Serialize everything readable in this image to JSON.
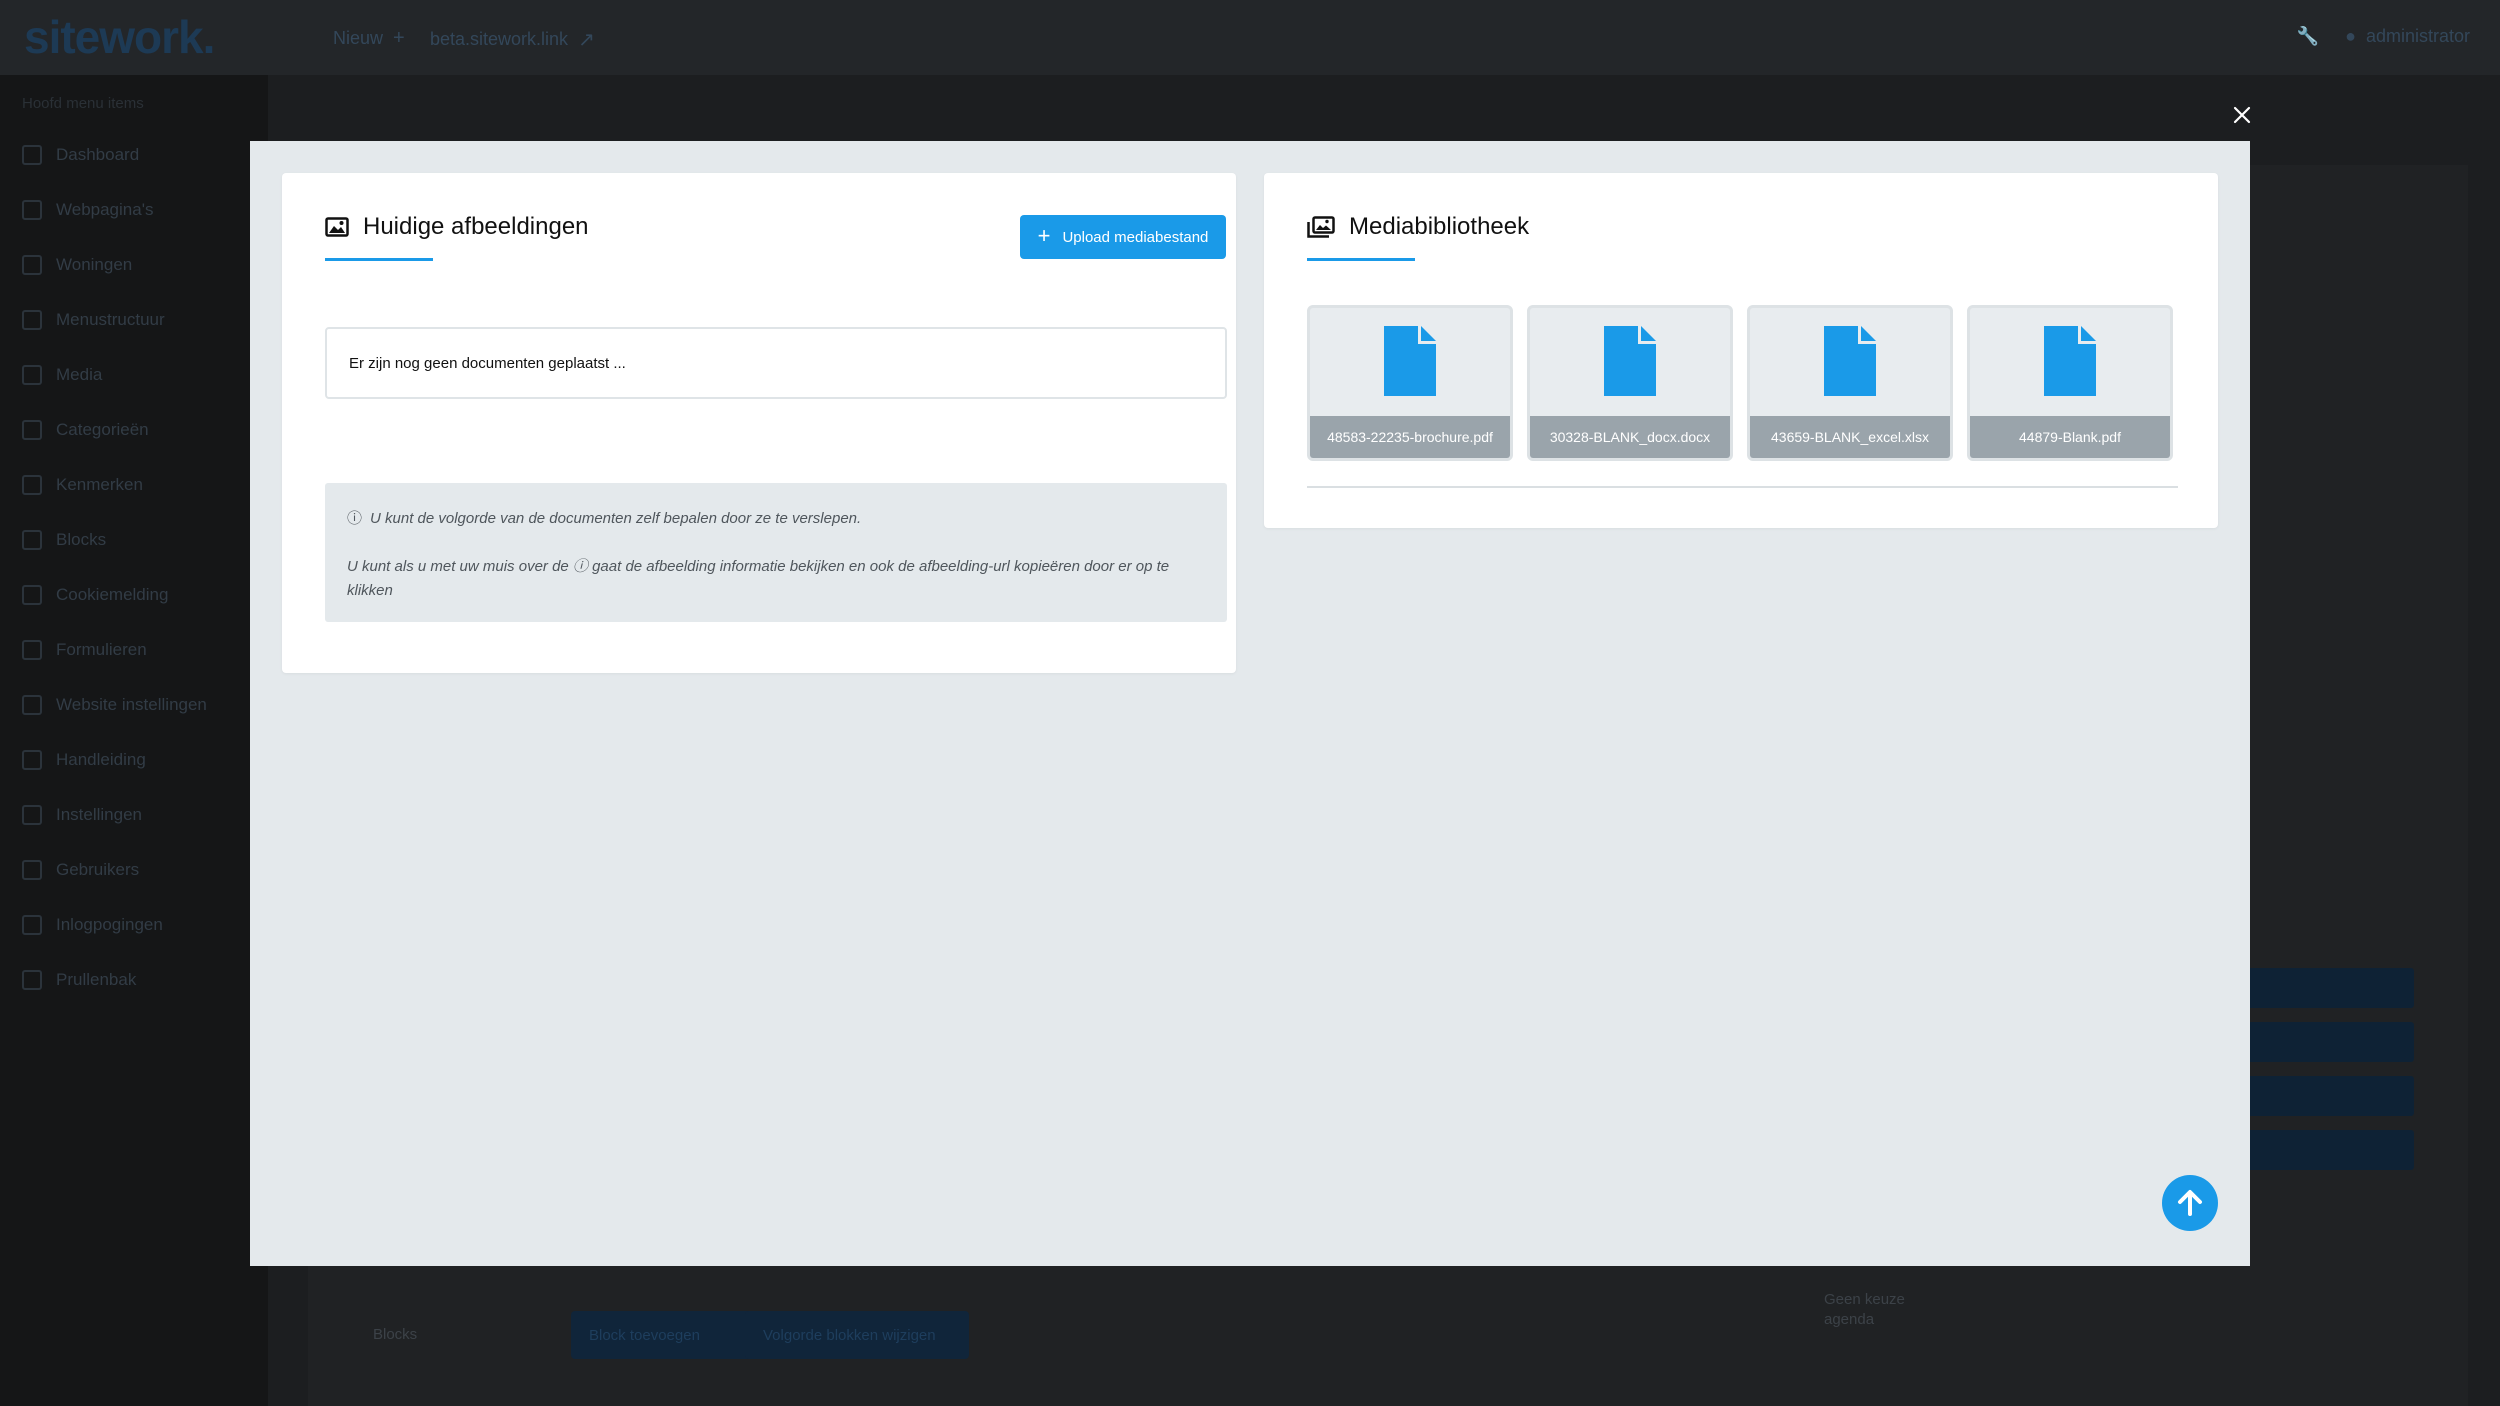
{
  "app": {
    "logo": "sitework.",
    "topnav": {
      "new_label": "Nieuw",
      "site_link_label": "beta.sitework.link"
    },
    "user": {
      "name": "administrator"
    }
  },
  "sidebar": {
    "section_title": "Hoofd menu items",
    "items": [
      {
        "label": "Dashboard",
        "icon": "dashboard-icon"
      },
      {
        "label": "Webpagina's",
        "icon": "pages-icon"
      },
      {
        "label": "Woningen",
        "icon": "home-icon"
      },
      {
        "label": "Menustructuur",
        "icon": "menu-icon"
      },
      {
        "label": "Media",
        "icon": "media-icon"
      },
      {
        "label": "Categorieën",
        "icon": "tag-icon"
      },
      {
        "label": "Kenmerken",
        "icon": "list-icon"
      },
      {
        "label": "Blocks",
        "icon": "blocks-icon"
      },
      {
        "label": "Cookiemelding",
        "icon": "cookie-icon"
      },
      {
        "label": "Formulieren",
        "icon": "form-icon"
      },
      {
        "label": "Website instellingen",
        "icon": "website-icon"
      },
      {
        "label": "Handleiding",
        "icon": "book-icon"
      },
      {
        "label": "Instellingen",
        "icon": "gear-icon"
      },
      {
        "label": "Gebruikers",
        "icon": "users-icon"
      },
      {
        "label": "Inlogpogingen",
        "icon": "lock-icon"
      },
      {
        "label": "Prullenbak",
        "icon": "trash-icon"
      }
    ]
  },
  "background": {
    "blocks_label": "Blocks",
    "add_block_label": "Block toevoegen",
    "order_label": "Volgorde blokken wijzigen",
    "agenda_text": "Geen keuze agenda"
  },
  "modal": {
    "current_images": {
      "title": "Huidige afbeeldingen",
      "upload_button": "Upload mediabestand",
      "empty_text": "Er zijn nog geen documenten geplaatst ...",
      "info_1": "U kunt de volgorde van de documenten zelf bepalen door ze te verslepen.",
      "info_2": "U kunt als u met uw muis over de ⓘ gaat de afbeelding informatie bekijken en ook de afbeelding-url kopieëren door er op te klikken"
    },
    "library": {
      "title": "Mediabibliotheek",
      "files": [
        "48583-22235-brochure.pdf",
        "30328-BLANK_docx.docx",
        "43659-BLANK_excel.xlsx",
        "44879-Blank.pdf"
      ]
    }
  },
  "colors": {
    "accent": "#1a9ae8",
    "modal_bg": "#e4e9ec",
    "tile_label_bg": "#9aa4ab"
  }
}
